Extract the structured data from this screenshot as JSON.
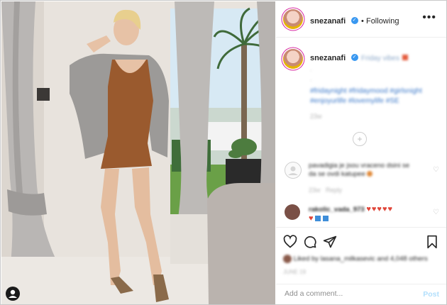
{
  "header": {
    "username": "snezanafi",
    "follow_state": "Following",
    "more_icon": "more-horizontal-icon"
  },
  "caption": {
    "username": "snezanafi",
    "text": "Friday vibes",
    "dot": ".",
    "hashtags_line1": "#fridaynight #fridaymood #girlsnight",
    "hashtags_line2": "#enjoyurlife #lovemylife #SE",
    "time": "23w"
  },
  "comments": [
    {
      "text_line1": "pavadigia je jsou vraceno dsini se",
      "text_line2": "da se ovdi katupee",
      "time": "23w",
      "reply_label": "Reply"
    },
    {
      "user": "rakolic_vada_973",
      "hearts": "♥♥♥♥♥",
      "hearts_line2": "♥",
      "time": "23w",
      "reply_label": "Reply"
    }
  ],
  "actions": {
    "like_icon": "heart-icon",
    "comment_icon": "comment-icon",
    "share_icon": "paper-plane-icon",
    "save_icon": "bookmark-icon"
  },
  "likes_text": "Liked by lasana_milkasevic and 4,048 others",
  "post_date": "JUNE 19",
  "add_comment": {
    "placeholder": "Add a comment...",
    "post_label": "Post"
  },
  "colors": {
    "verified": "#3897f0",
    "link": "#3b78c9",
    "post_button": "#b2dffc"
  }
}
